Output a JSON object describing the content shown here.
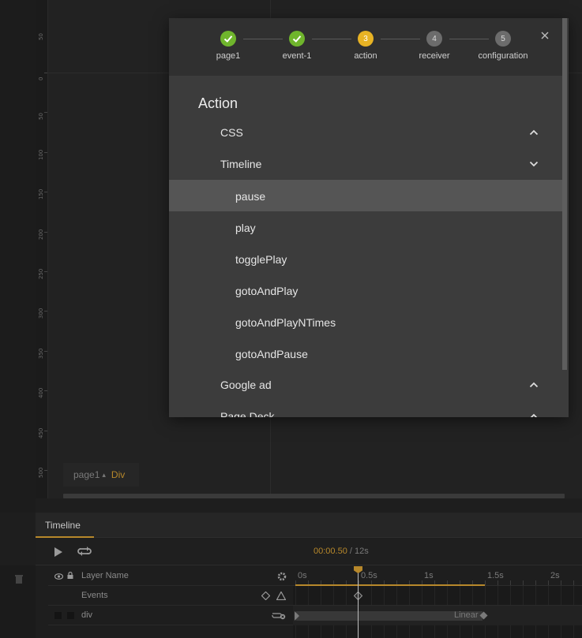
{
  "stepper": {
    "steps": [
      {
        "label": "page1",
        "state": "done",
        "num": ""
      },
      {
        "label": "event-1",
        "state": "done",
        "num": ""
      },
      {
        "label": "action",
        "state": "active",
        "num": "3"
      },
      {
        "label": "receiver",
        "state": "todo",
        "num": "4"
      },
      {
        "label": "configuration",
        "state": "todo",
        "num": "5"
      }
    ]
  },
  "modal": {
    "title": "Action",
    "groups": [
      {
        "label": "CSS",
        "expanded": false
      },
      {
        "label": "Timeline",
        "expanded": true
      },
      {
        "label": "Google ad",
        "expanded": false
      },
      {
        "label": "Page Deck",
        "expanded": false
      }
    ],
    "timeline_items": [
      "pause",
      "play",
      "togglePlay",
      "gotoAndPlay",
      "gotoAndPlayNTimes",
      "gotoAndPause"
    ],
    "selected_item": "pause"
  },
  "canvas": {
    "page_selector": "page1",
    "element_type": "Div",
    "ruler_labels": [
      "0",
      "50",
      "100",
      "150",
      "200",
      "250",
      "300",
      "350",
      "400",
      "450",
      "500"
    ]
  },
  "timeline": {
    "tab_label": "Timeline",
    "current_time": "00:00.50",
    "total_time": " / 12s",
    "layer_header": "Layer Name",
    "rows": [
      {
        "name": "Events"
      },
      {
        "name": "div"
      }
    ],
    "ruler_labels": [
      "0s",
      "0.5s",
      "1s",
      "1.5s",
      "2s"
    ],
    "easing_label": "Linear"
  },
  "colors": {
    "accent": "#b7882b",
    "done": "#6fb52c",
    "active_step": "#e8b324"
  }
}
